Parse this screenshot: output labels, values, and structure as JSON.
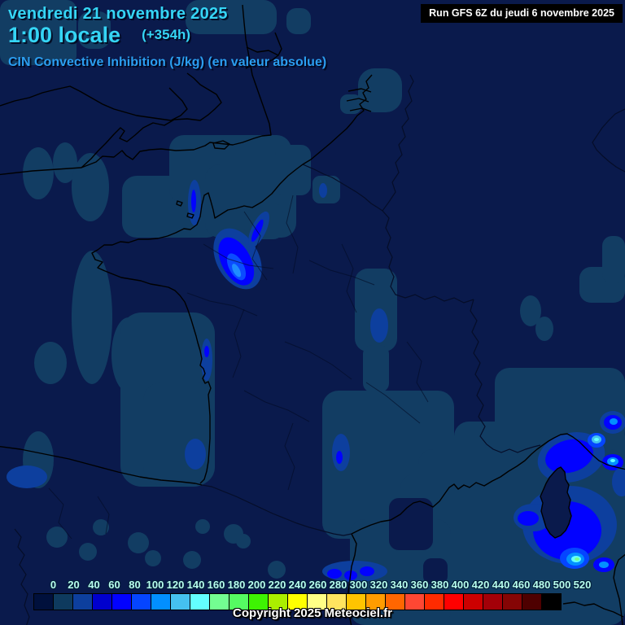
{
  "header": {
    "date": "vendredi 21 novembre 2025",
    "time": "1:00 locale",
    "forecast_offset": "(+354h)",
    "run_info": "Run GFS 6Z du jeudi 6 novembre 2025",
    "subtitle": "CIN Convective Inhibition (J/kg) (en valeur absolue)"
  },
  "legend": {
    "unit": "J/kg",
    "values": [
      0,
      20,
      40,
      60,
      80,
      100,
      120,
      140,
      160,
      180,
      200,
      220,
      240,
      260,
      280,
      300,
      320,
      340,
      360,
      380,
      400,
      420,
      440,
      460,
      480,
      500,
      520
    ],
    "colors": [
      "#00103c",
      "#0e3a5e",
      "#0d3f9e",
      "#0000cd",
      "#0202ff",
      "#0545ff",
      "#028fff",
      "#45c1ef",
      "#63ffff",
      "#73fd91",
      "#55fb62",
      "#3ef303",
      "#aaee00",
      "#ffff00",
      "#ffff86",
      "#ffe45f",
      "#ffc400",
      "#ff9c00",
      "#ff6600",
      "#ff4733",
      "#ff2b00",
      "#ff0000",
      "#cc0000",
      "#a30008",
      "#850505",
      "#4e0000",
      "#000000"
    ]
  },
  "footer": {
    "copyright": "Copyright 2025 Meteociel.fr"
  },
  "map_colors": {
    "base": "#0a1a4c",
    "level_20": "#123d63",
    "level_40": "#0d3f9e",
    "level_60": "#0202ff",
    "level_100": "#0545ff",
    "level_120": "#028fff",
    "level_140": "#45c1ef",
    "level_160": "#63ffff",
    "level_180": "#73fd91",
    "coastline": "#000000",
    "header_text": "#35d5f5",
    "subtitle_text": "#2b9ef0",
    "legend_label_text": "#b8ffee",
    "run_box_bg": "#000000",
    "run_box_text": "#ffffff"
  }
}
